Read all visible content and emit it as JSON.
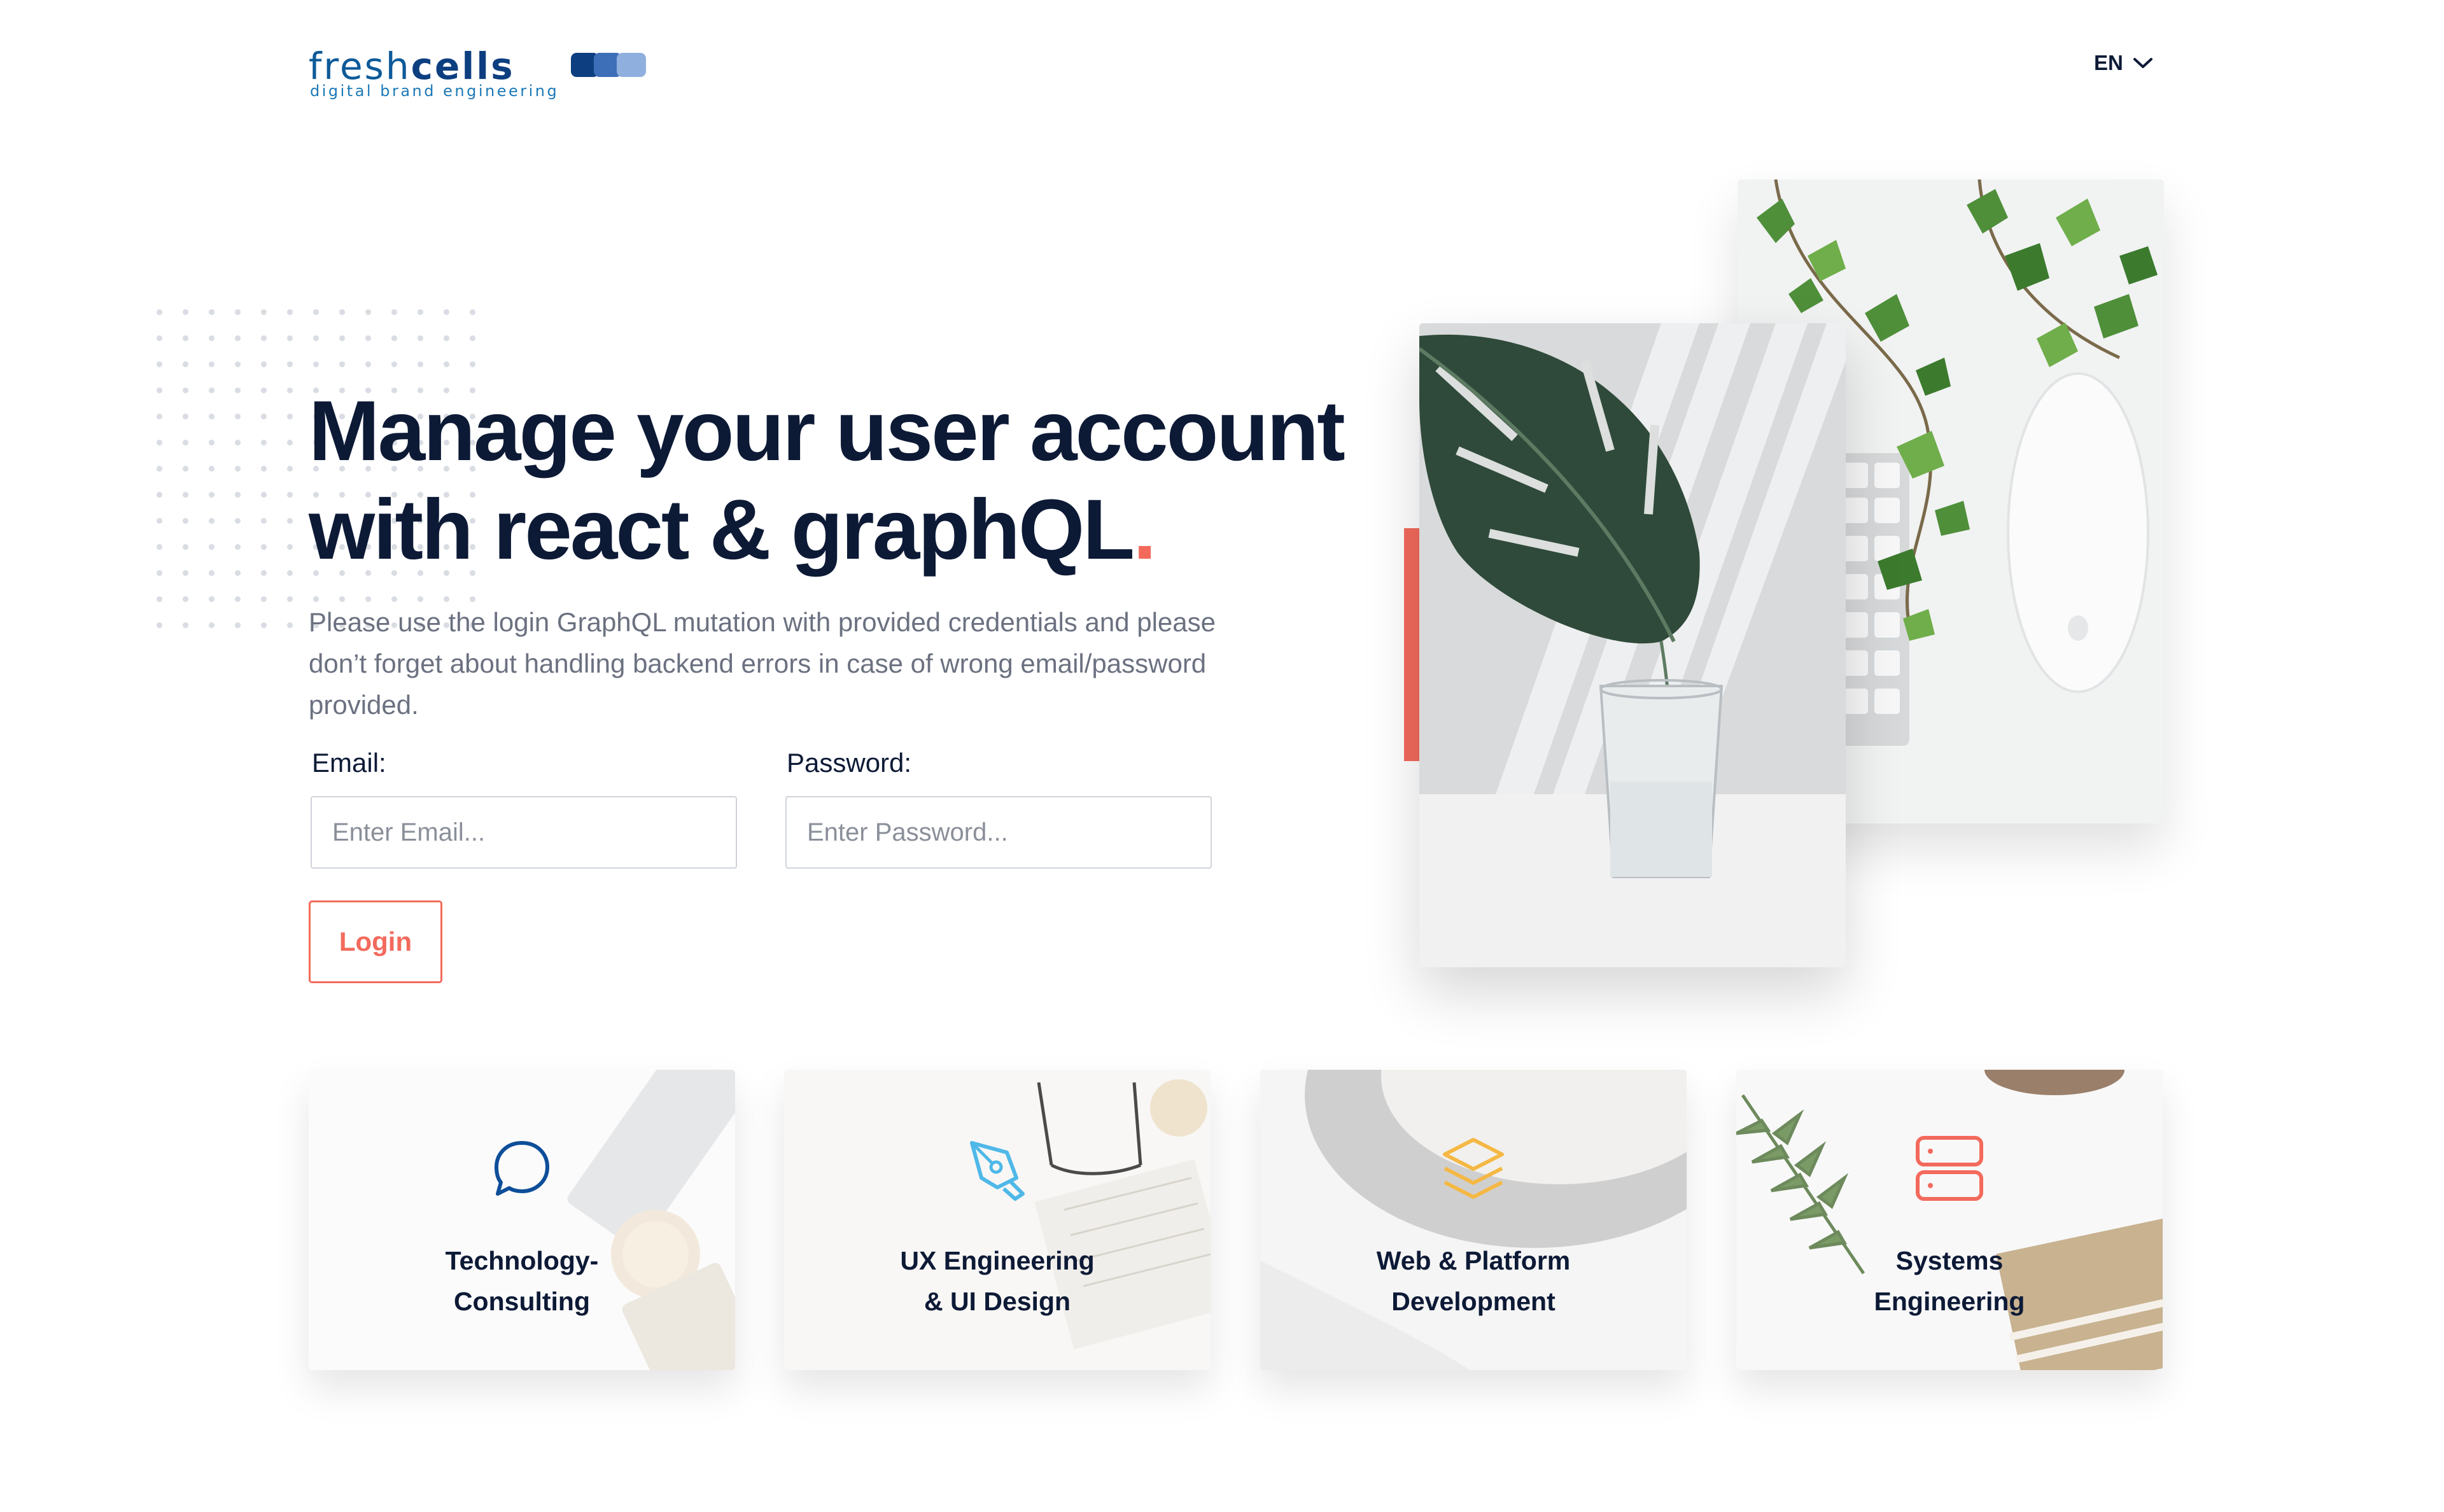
{
  "header": {
    "logo": {
      "word_light": "fresh",
      "word_bold": "cells",
      "tagline": "digital brand engineering",
      "box_colors": [
        "#0d3f80",
        "#3d6fb8",
        "#8fb0de"
      ]
    },
    "language": {
      "selected": "EN",
      "icon": "chevron-down-icon"
    }
  },
  "hero": {
    "title_line1": "Manage your user account",
    "title_line2": "with react & graphQL",
    "title_dot": ".",
    "description": "Please use the login GraphQL mutation with provided credentials and please don’t forget about handling backend errors in case of wrong email/password provided."
  },
  "form": {
    "email": {
      "label": "Email:",
      "placeholder": "Enter Email...",
      "value": ""
    },
    "password": {
      "label": "Password:",
      "placeholder": "Enter Password...",
      "value": ""
    },
    "login_label": "Login"
  },
  "cards": [
    {
      "line1": "Technology-",
      "line2": "Consulting",
      "icon": "chat-bubble-icon",
      "color": "#0d4e99"
    },
    {
      "line1": "UX Engineering",
      "line2": "& UI Design",
      "icon": "pen-tool-icon",
      "color": "#4fb8e8"
    },
    {
      "line1": "Web & Platform",
      "line2": "Development",
      "icon": "layers-icon",
      "color": "#f5b844"
    },
    {
      "line1": "Systems",
      "line2": "Engineering",
      "icon": "server-icon",
      "color": "#f36a5c"
    }
  ],
  "colors": {
    "accent": "#f36a5c",
    "text_dark": "#0d1a36",
    "text_muted": "#6b7180",
    "brand_blue": "#0d5a99"
  }
}
